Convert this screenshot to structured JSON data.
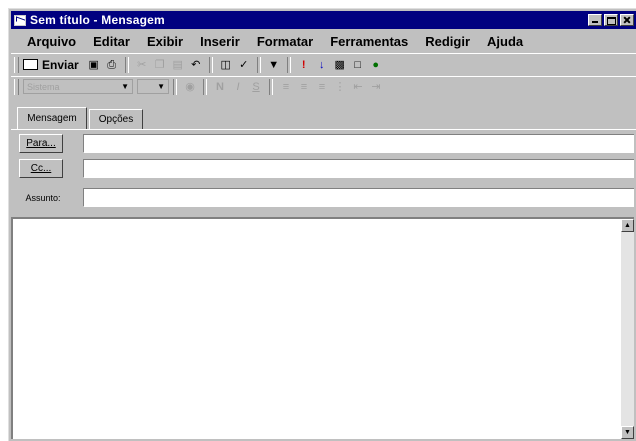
{
  "window": {
    "title": "Sem título - Mensagem"
  },
  "menu": [
    "Arquivo",
    "Editar",
    "Exibir",
    "Inserir",
    "Formatar",
    "Ferramentas",
    "Redigir",
    "Ajuda"
  ],
  "toolbar": {
    "send_label": "Enviar",
    "font_placeholder": "Sistema"
  },
  "tabs": {
    "message": "Mensagem",
    "options": "Opções"
  },
  "headers": {
    "to_label": "Para...",
    "cc_label": "Cc...",
    "subject_label": "Assunto:"
  }
}
